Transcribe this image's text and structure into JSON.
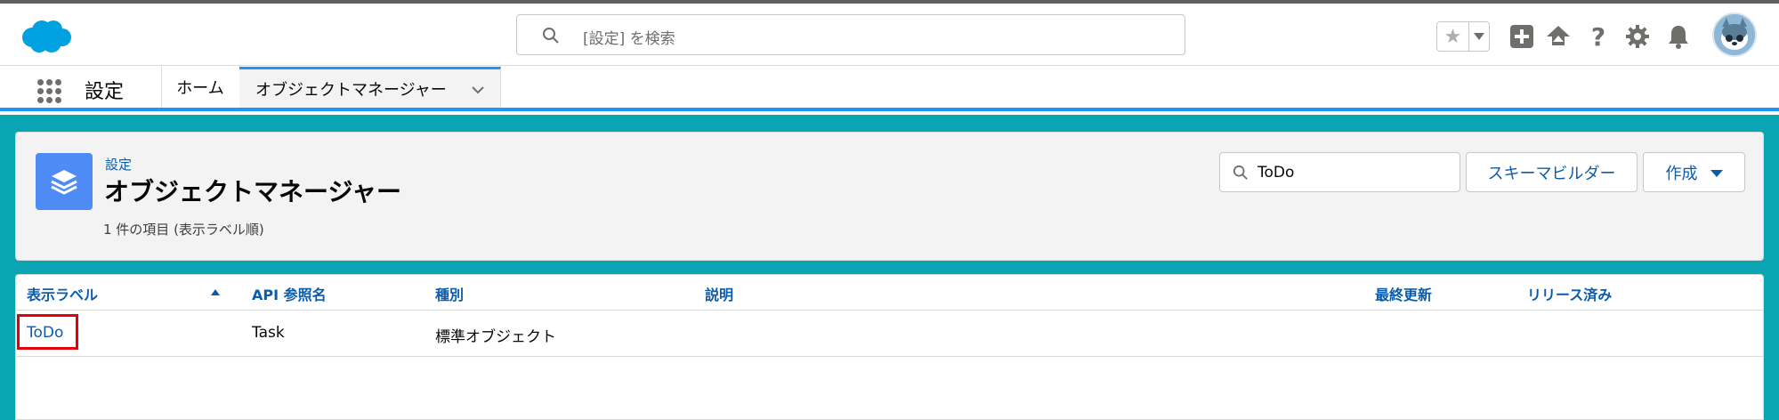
{
  "header": {
    "search_placeholder": "[設定] を検索",
    "help_glyph": "?"
  },
  "nav": {
    "app_title": "設定",
    "tabs": [
      {
        "label": "ホーム"
      },
      {
        "label": "オブジェクトマネージャー"
      }
    ]
  },
  "page": {
    "breadcrumb": "設定",
    "title": "オブジェクトマネージャー",
    "item_count": "1 件の項目 (表示ラベル順)",
    "quick_find_value": "ToDo",
    "schema_builder_label": "スキーマビルダー",
    "create_label": "作成"
  },
  "table": {
    "columns": [
      "表示ラベル",
      "API 参照名",
      "種別",
      "説明",
      "最終更新",
      "リリース済み"
    ],
    "sorted_column": "表示ラベル",
    "sort_direction": "ascending",
    "rows": [
      {
        "label": "ToDo",
        "api_name": "Task",
        "type": "標準オブジェクト",
        "description": "",
        "last_modified": "",
        "deployed": ""
      }
    ]
  },
  "colors": {
    "brand_blue": "#1b96ff",
    "link_blue": "#0b5cab",
    "background_teal": "#0aa5b2",
    "object_icon_blue": "#4f8bf5",
    "highlight_red": "#e3000b"
  }
}
